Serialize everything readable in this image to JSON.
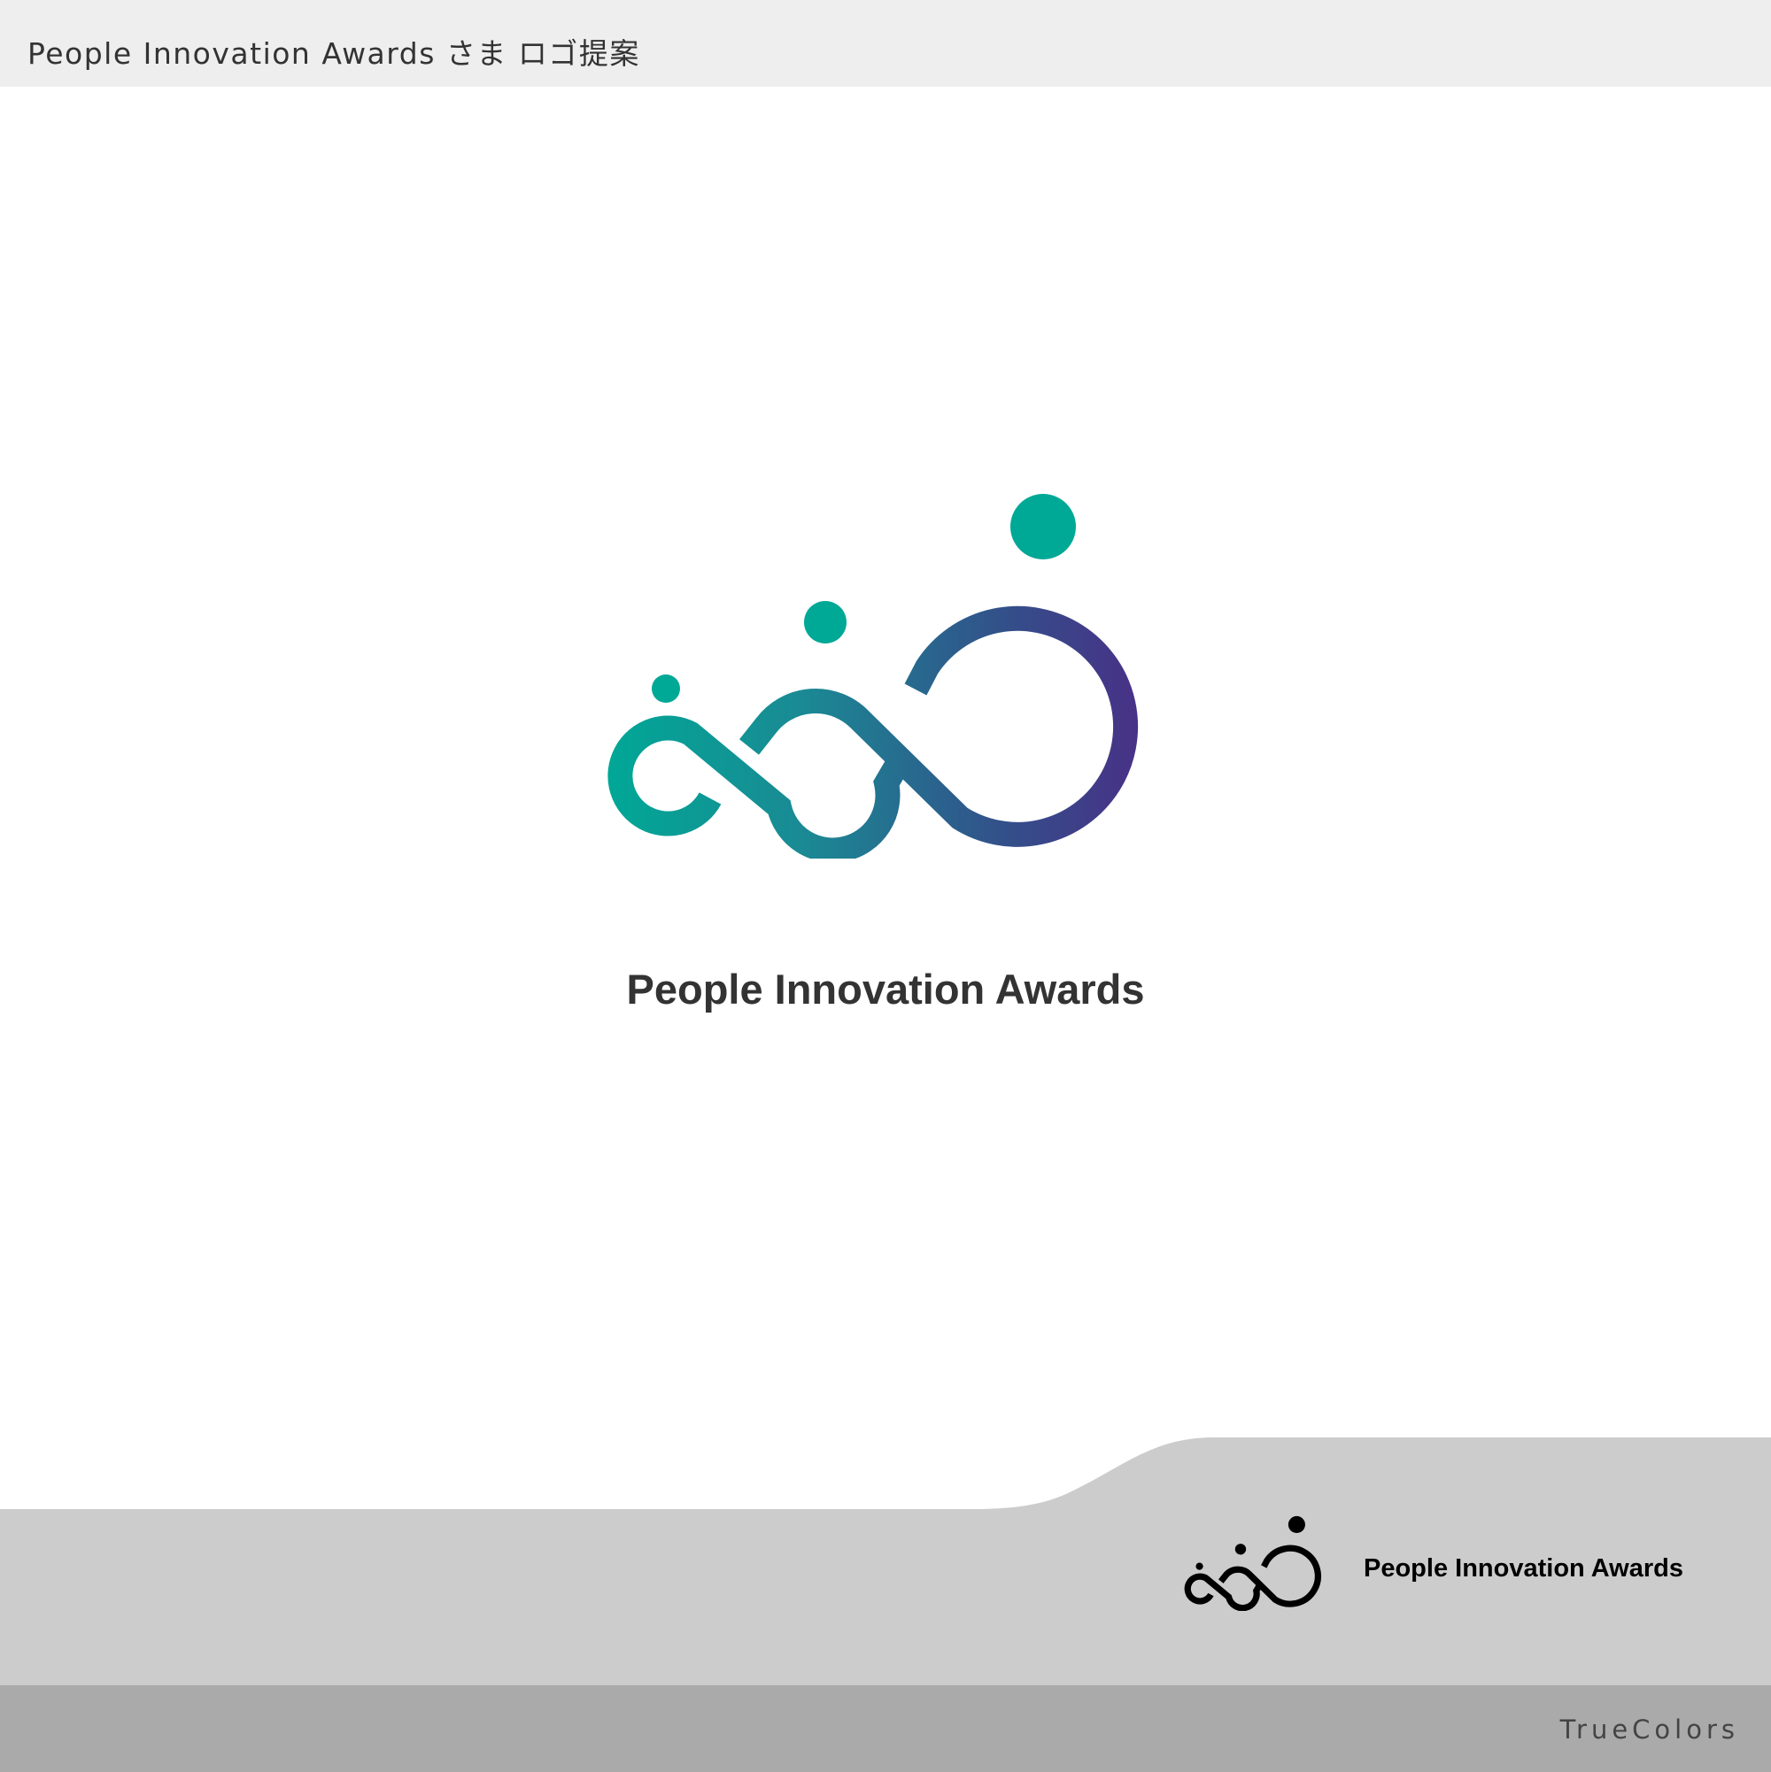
{
  "header": {
    "title": "People Innovation Awards さま ロゴ提案"
  },
  "main": {
    "wordmark": "People Innovation Awards",
    "logo_colors": {
      "teal": "#00a896",
      "purple": "#4d2a86"
    }
  },
  "footer": {
    "wordmark": "People Innovation Awards",
    "logo_color": "#000000",
    "band_color": "#cccccc",
    "bar_color": "#aaaaaa",
    "credit": "TrueColors"
  }
}
